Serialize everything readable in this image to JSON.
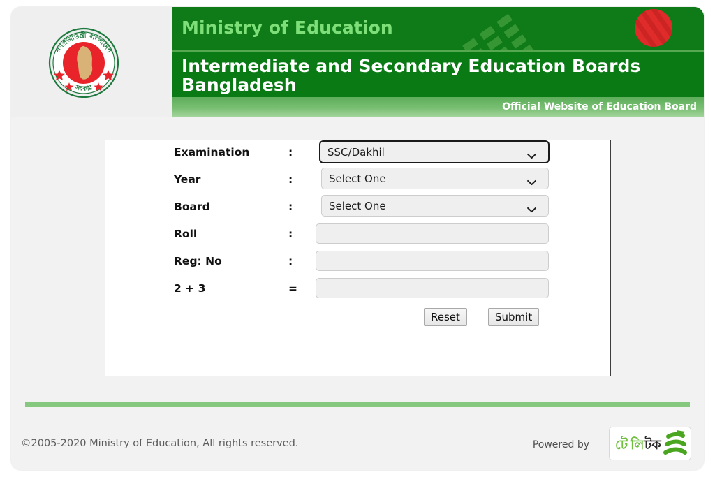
{
  "header": {
    "logo_alt": "Government of Bangladesh national emblem",
    "ministry_title": "Ministry of Education",
    "boards_title": "Intermediate and Secondary Education Boards Bangladesh",
    "official_tagline": "Official Website of Education Board",
    "colors": {
      "header_green": "#0f7a18",
      "ministry_text_green": "#7ede78",
      "tagline_bar_green": "#79bf73",
      "divider_green": "#84c97e"
    }
  },
  "form": {
    "rows": [
      {
        "label": "Examination",
        "separator": ":",
        "type": "select",
        "value": "SSC/Dakhil",
        "focused": true,
        "name": "examination"
      },
      {
        "label": "Year",
        "separator": ":",
        "type": "select",
        "value": "Select One",
        "focused": false,
        "name": "year"
      },
      {
        "label": "Board",
        "separator": ":",
        "type": "select",
        "value": "Select One",
        "focused": false,
        "name": "board"
      },
      {
        "label": "Roll",
        "separator": ":",
        "type": "text",
        "value": "",
        "placeholder": "",
        "name": "roll"
      },
      {
        "label": "Reg: No",
        "separator": ":",
        "type": "text",
        "value": "",
        "placeholder": "",
        "name": "registration-no"
      },
      {
        "label": "2 + 3",
        "separator": "=",
        "type": "text",
        "value": "",
        "placeholder": "",
        "name": "captcha-sum"
      }
    ],
    "reset_label": "Reset",
    "submit_label": "Submit"
  },
  "footer": {
    "copyright": "©2005-2020 Ministry of Education, All rights reserved.",
    "powered_by": "Powered by",
    "partner_logo_text": "টেলিটক",
    "partner_logo_name": "teletalk-logo"
  }
}
